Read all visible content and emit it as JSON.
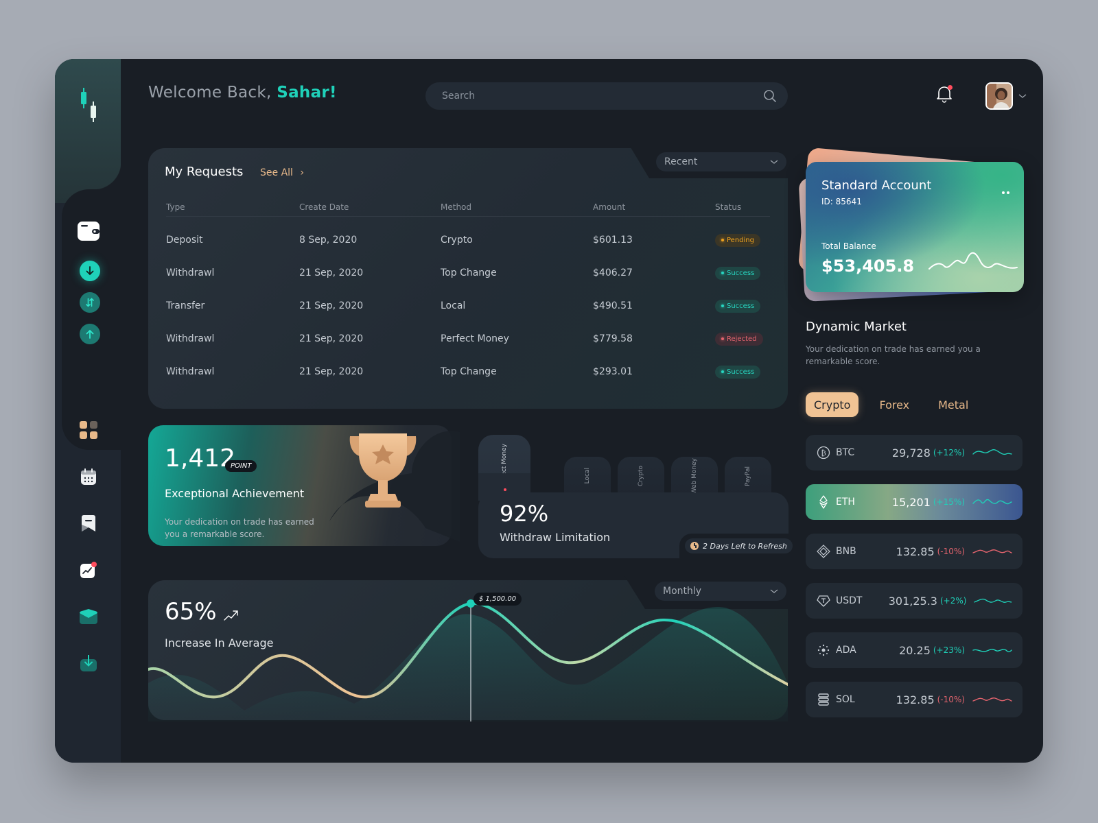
{
  "header": {
    "welcome_prefix": "Welcome Back,",
    "user_name": "Sahar!",
    "search_placeholder": "Search",
    "notification_dot": true
  },
  "sidebar": {
    "logo": "candlestick-logo",
    "top_items": [
      {
        "name": "wallet",
        "icon": "wallet-icon"
      },
      {
        "name": "deposit",
        "icon": "arrow-down-icon",
        "active": true
      },
      {
        "name": "transfer",
        "icon": "transfer-arrows-icon"
      },
      {
        "name": "withdraw",
        "icon": "arrow-up-icon"
      }
    ],
    "bottom_items": [
      {
        "name": "dashboard",
        "icon": "grid-icon",
        "active": true
      },
      {
        "name": "calendar",
        "icon": "calendar-icon"
      },
      {
        "name": "bookmark",
        "icon": "bookmark-icon"
      },
      {
        "name": "analytics",
        "icon": "chart-icon",
        "badge": true
      },
      {
        "name": "messages",
        "icon": "mail-icon"
      },
      {
        "name": "download",
        "icon": "download-icon"
      }
    ]
  },
  "requests": {
    "title": "My Requests",
    "see_all": "See All",
    "filter": "Recent",
    "columns": [
      "Type",
      "Create Date",
      "Method",
      "Amount",
      "Status"
    ],
    "rows": [
      {
        "type": "Deposit",
        "date": "8 Sep, 2020",
        "method": "Crypto",
        "amount": "$601.13",
        "status": "Pending"
      },
      {
        "type": "Withdrawl",
        "date": "21 Sep, 2020",
        "method": "Top Change",
        "amount": "$406.27",
        "status": "Success"
      },
      {
        "type": "Transfer",
        "date": "21 Sep, 2020",
        "method": "Local",
        "amount": "$490.51",
        "status": "Success"
      },
      {
        "type": "Withdrawl",
        "date": "21 Sep, 2020",
        "method": "Perfect Money",
        "amount": "$779.58",
        "status": "Rejected"
      },
      {
        "type": "Withdrawl",
        "date": "21 Sep, 2020",
        "method": "Top Change",
        "amount": "$293.01",
        "status": "Success"
      }
    ]
  },
  "achievement": {
    "points": "1,412",
    "points_badge": "POINT",
    "title": "Exceptional Achievement",
    "description": "Your dedication on trade has earned you a remarkable score."
  },
  "withdraw": {
    "percent": "92%",
    "label": "Withdraw Limitation",
    "methods": [
      "Perfect Money",
      "Local",
      "Crypto",
      "Web Money",
      "PayPal"
    ],
    "active_method": "Perfect Money",
    "refresh_note": "2 Days Left to Refresh"
  },
  "average_chart": {
    "percent": "65%",
    "label": "Increase In Average",
    "filter": "Monthly",
    "tooltip": "$ 1,500.00"
  },
  "account": {
    "title": "Standard Account",
    "id_label": "ID:",
    "id": "85641",
    "balance_label": "Total Balance",
    "balance": "$53,405.8"
  },
  "market": {
    "title": "Dynamic Market",
    "description": "Your dedication on trade has earned you a remarkable score.",
    "tabs": [
      "Crypto",
      "Forex",
      "Metal"
    ],
    "active_tab": "Crypto",
    "coins": [
      {
        "symbol": "BTC",
        "price": "29,728",
        "change": "(+12%)",
        "direction": "up",
        "icon": "bitcoin-icon"
      },
      {
        "symbol": "ETH",
        "price": "15,201",
        "change": "(+15%)",
        "direction": "up",
        "icon": "ethereum-icon",
        "active": true
      },
      {
        "symbol": "BNB",
        "price": "132.85",
        "change": "(-10%)",
        "direction": "down",
        "icon": "binance-icon"
      },
      {
        "symbol": "USDT",
        "price": "301,25.3",
        "change": "(+2%)",
        "direction": "up",
        "icon": "tether-icon"
      },
      {
        "symbol": "ADA",
        "price": "20.25",
        "change": "(+23%)",
        "direction": "up",
        "icon": "cardano-icon"
      },
      {
        "symbol": "SOL",
        "price": "132.85",
        "change": "(-10%)",
        "direction": "down",
        "icon": "solana-icon"
      }
    ]
  },
  "colors": {
    "accent": "#1fd1b9",
    "peach": "#f0c394",
    "danger": "#e4646e",
    "pending": "#f0a31e",
    "background": "#191e25",
    "panel": "#232b35"
  }
}
